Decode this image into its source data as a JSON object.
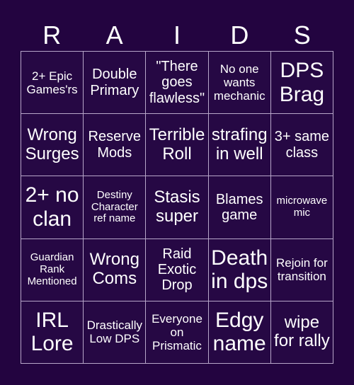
{
  "title_letters": [
    "R",
    "A",
    "I",
    "D",
    "S"
  ],
  "colors": {
    "background": "#230440",
    "grid_line": "#b7a6c9",
    "text": "#ffffff"
  },
  "cells": [
    [
      "2+ Epic Games'rs",
      "Double Primary",
      "\"There goes flawless\"",
      "No one wants mechanic",
      "DPS Brag"
    ],
    [
      "Wrong Surges",
      "Reserve Mods",
      "Terrible Roll",
      "strafing in well",
      "3+ same class"
    ],
    [
      "2+ no clan",
      "Destiny Character ref name",
      "Stasis super",
      "Blames game",
      "microwave mic"
    ],
    [
      "Guardian Rank Mentioned",
      "Wrong Coms",
      "Raid Exotic Drop",
      "Death in dps",
      "Rejoin for transition"
    ],
    [
      "IRL Lore",
      "Drastically Low DPS",
      "Everyone on Prismatic",
      "Edgy name",
      "wipe for rally"
    ]
  ]
}
